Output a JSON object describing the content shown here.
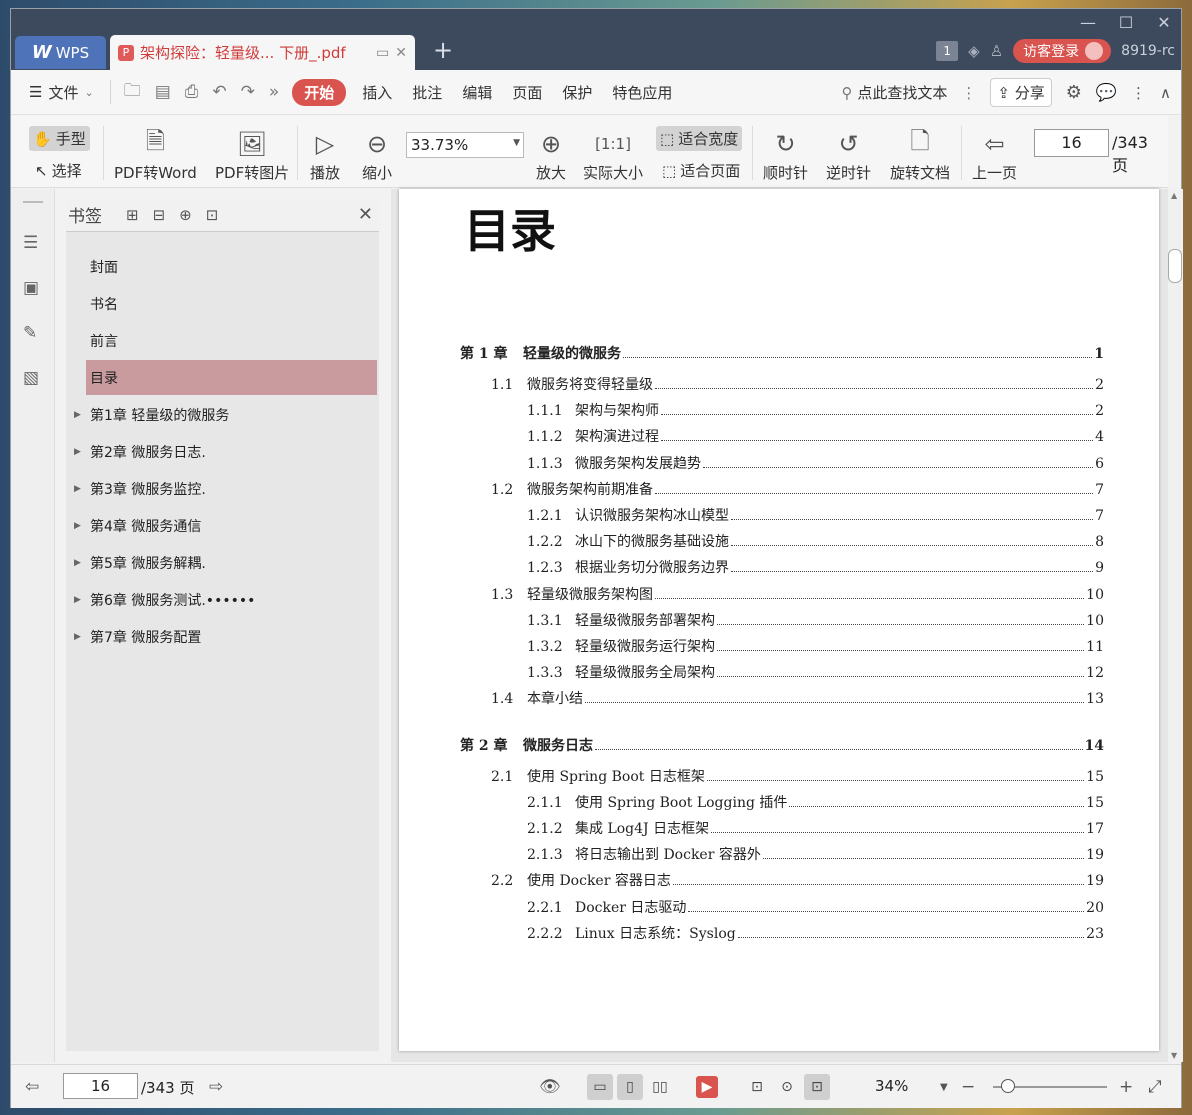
{
  "tabs": {
    "wps": "WPS",
    "doc": "架构探险：轻量级... 下册_.pdf"
  },
  "titlebar": {
    "page_badge": "1",
    "login": "访客登录",
    "version": "8919-rc"
  },
  "menu": {
    "file": "文件",
    "items": [
      "开始",
      "插入",
      "批注",
      "编辑",
      "页面",
      "保护",
      "特色应用"
    ],
    "search": "点此查找文本",
    "share": "分享"
  },
  "ribbon": {
    "hand": "手型",
    "select": "选择",
    "pdf2word": "PDF转Word",
    "pdf2img": "PDF转图片",
    "play": "播放",
    "zoom_out": "缩小",
    "zoom_value": "33.73%",
    "zoom_in": "放大",
    "actual": "实际大小",
    "fit_width": "适合宽度",
    "fit_page": "适合页面",
    "cw": "顺时针",
    "ccw": "逆时针",
    "rotate": "旋转文档",
    "prev": "上一页",
    "page": "16",
    "total": "/343 页"
  },
  "bookmarks": {
    "title": "书签",
    "items": [
      {
        "label": "封面",
        "expandable": false,
        "selected": false
      },
      {
        "label": "书名",
        "expandable": false,
        "selected": false
      },
      {
        "label": "前言",
        "expandable": false,
        "selected": false
      },
      {
        "label": "目录",
        "expandable": false,
        "selected": true
      },
      {
        "label": "第1章 轻量级的微服务",
        "expandable": true,
        "selected": false
      },
      {
        "label": "第2章 微服务日志.",
        "expandable": true,
        "selected": false
      },
      {
        "label": "第3章 微服务监控.",
        "expandable": true,
        "selected": false
      },
      {
        "label": "第4章 微服务通信",
        "expandable": true,
        "selected": false
      },
      {
        "label": "第5章 微服务解耦.",
        "expandable": true,
        "selected": false
      },
      {
        "label": "第6章 微服务测试.••••••",
        "expandable": true,
        "selected": false
      },
      {
        "label": "第7章 微服务配置",
        "expandable": true,
        "selected": false
      }
    ]
  },
  "document": {
    "title": "目录",
    "toc": [
      {
        "level": 0,
        "num": "第 1 章",
        "label": "轻量级的微服务",
        "page": "1"
      },
      {
        "level": 1,
        "num": "1.1",
        "label": "微服务将变得轻量级",
        "page": "2"
      },
      {
        "level": 2,
        "num": "1.1.1",
        "label": "架构与架构师",
        "page": "2"
      },
      {
        "level": 2,
        "num": "1.1.2",
        "label": "架构演进过程",
        "page": "4"
      },
      {
        "level": 2,
        "num": "1.1.3",
        "label": "微服务架构发展趋势",
        "page": "6"
      },
      {
        "level": 1,
        "num": "1.2",
        "label": "微服务架构前期准备",
        "page": "7"
      },
      {
        "level": 2,
        "num": "1.2.1",
        "label": "认识微服务架构冰山模型",
        "page": "7"
      },
      {
        "level": 2,
        "num": "1.2.2",
        "label": "冰山下的微服务基础设施",
        "page": "8"
      },
      {
        "level": 2,
        "num": "1.2.3",
        "label": "根据业务切分微服务边界",
        "page": "9"
      },
      {
        "level": 1,
        "num": "1.3",
        "label": "轻量级微服务架构图",
        "page": "10"
      },
      {
        "level": 2,
        "num": "1.3.1",
        "label": "轻量级微服务部署架构",
        "page": "10"
      },
      {
        "level": 2,
        "num": "1.3.2",
        "label": "轻量级微服务运行架构",
        "page": "11"
      },
      {
        "level": 2,
        "num": "1.3.3",
        "label": "轻量级微服务全局架构",
        "page": "12"
      },
      {
        "level": 1,
        "num": "1.4",
        "label": "本章小结",
        "page": "13"
      },
      {
        "level": 0,
        "num": "第 2 章",
        "label": "微服务日志",
        "page": "14"
      },
      {
        "level": 1,
        "num": "2.1",
        "label": "使用 Spring Boot 日志框架",
        "page": "15"
      },
      {
        "level": 2,
        "num": "2.1.1",
        "label": "使用 Spring Boot Logging 插件",
        "page": "15"
      },
      {
        "level": 2,
        "num": "2.1.2",
        "label": "集成 Log4J 日志框架",
        "page": "17"
      },
      {
        "level": 2,
        "num": "2.1.3",
        "label": "将日志输出到 Docker 容器外",
        "page": "19"
      },
      {
        "level": 1,
        "num": "2.2",
        "label": "使用 Docker 容器日志",
        "page": "19"
      },
      {
        "level": 2,
        "num": "2.2.1",
        "label": "Docker 日志驱动",
        "page": "20"
      },
      {
        "level": 2,
        "num": "2.2.2",
        "label": "Linux 日志系统：Syslog",
        "page": "23"
      }
    ]
  },
  "status": {
    "page": "16",
    "total": "/343 页",
    "zoom": "34%"
  }
}
